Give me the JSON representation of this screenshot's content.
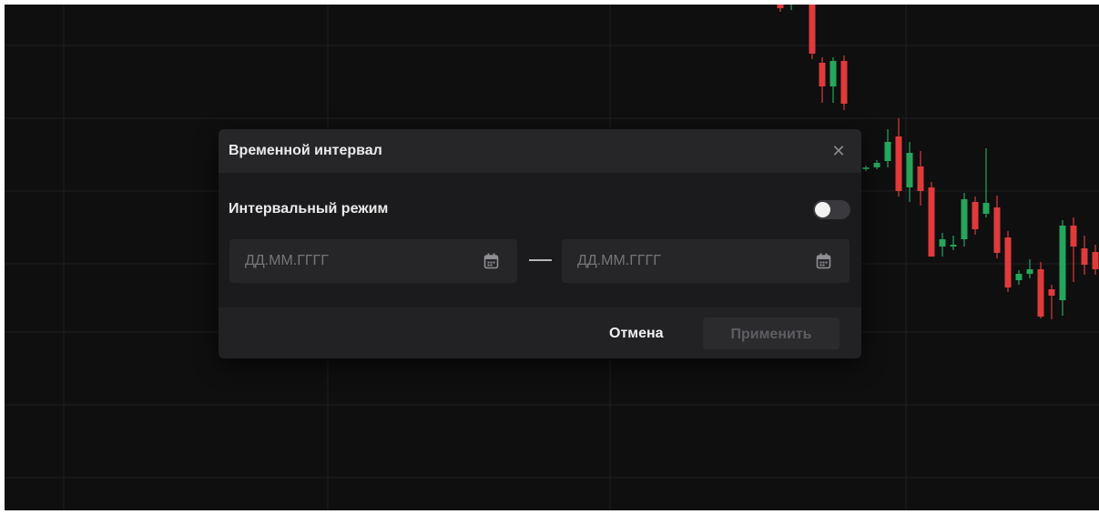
{
  "chart_data": {
    "type": "candlestick",
    "colors": {
      "up": "#26a65b",
      "down": "#e03a3a",
      "grid": "#1f1f22",
      "background": "#0f0f10"
    },
    "candles": [
      {
        "dir": "down",
        "open": 546,
        "close": 530,
        "high": 558,
        "low": 526
      },
      {
        "dir": "up",
        "open": 538,
        "close": 541,
        "high": 551,
        "low": 528
      },
      {
        "dir": "up",
        "open": 538,
        "close": 546,
        "high": 558,
        "low": 535
      },
      {
        "dir": "down",
        "open": 542,
        "close": 480,
        "high": 546,
        "low": 474
      },
      {
        "dir": "down",
        "open": 470,
        "close": 444,
        "high": 476,
        "low": 426
      },
      {
        "dir": "up",
        "open": 444,
        "close": 472,
        "high": 476,
        "low": 426
      },
      {
        "dir": "down",
        "open": 472,
        "close": 425,
        "high": 478,
        "low": 418
      },
      {
        "dir": "up",
        "open": 353,
        "close": 355,
        "high": 357,
        "low": 351
      },
      {
        "dir": "up",
        "open": 355,
        "close": 360,
        "high": 363,
        "low": 353
      },
      {
        "dir": "up",
        "open": 362,
        "close": 383,
        "high": 397,
        "low": 355
      },
      {
        "dir": "down",
        "open": 389,
        "close": 329,
        "high": 409,
        "low": 323
      },
      {
        "dir": "up",
        "open": 333,
        "close": 371,
        "high": 383,
        "low": 317
      },
      {
        "dir": "down",
        "open": 356,
        "close": 329,
        "high": 373,
        "low": 313
      },
      {
        "dir": "down",
        "open": 333,
        "close": 257,
        "high": 339,
        "low": 257
      },
      {
        "dir": "up",
        "open": 268,
        "close": 276,
        "high": 283,
        "low": 257
      },
      {
        "dir": "up",
        "open": 268,
        "close": 270,
        "high": 280,
        "low": 264
      },
      {
        "dir": "up",
        "open": 276,
        "close": 320,
        "high": 327,
        "low": 268
      },
      {
        "dir": "down",
        "open": 317,
        "close": 287,
        "high": 323,
        "low": 281
      },
      {
        "dir": "up",
        "open": 304,
        "close": 316,
        "high": 376,
        "low": 300
      },
      {
        "dir": "down",
        "open": 311,
        "close": 261,
        "high": 324,
        "low": 255
      },
      {
        "dir": "down",
        "open": 278,
        "close": 223,
        "high": 285,
        "low": 218
      },
      {
        "dir": "up",
        "open": 231,
        "close": 238,
        "high": 242,
        "low": 226
      },
      {
        "dir": "up",
        "open": 238,
        "close": 243,
        "high": 254,
        "low": 233
      },
      {
        "dir": "down",
        "open": 243,
        "close": 191,
        "high": 251,
        "low": 189
      },
      {
        "dir": "down",
        "open": 221,
        "close": 214,
        "high": 226,
        "low": 188
      },
      {
        "dir": "up",
        "open": 209,
        "close": 291,
        "high": 297,
        "low": 192
      },
      {
        "dir": "down",
        "open": 291,
        "close": 268,
        "high": 300,
        "low": 229
      },
      {
        "dir": "down",
        "open": 266,
        "close": 248,
        "high": 280,
        "low": 237
      },
      {
        "dir": "down",
        "open": 262,
        "close": 243,
        "high": 270,
        "low": 237
      }
    ]
  },
  "dialog": {
    "title": "Временной интервал",
    "close_glyph": "✕",
    "interval_mode_label": "Интервальный режим",
    "interval_mode_enabled": false,
    "date_from": {
      "value": "",
      "placeholder": "ДД.ММ.ГГГГ"
    },
    "date_to": {
      "value": "",
      "placeholder": "ДД.ММ.ГГГГ"
    },
    "calendar_icon": "calendar-icon",
    "cancel_label": "Отмена",
    "apply_label": "Применить",
    "apply_enabled": false
  }
}
